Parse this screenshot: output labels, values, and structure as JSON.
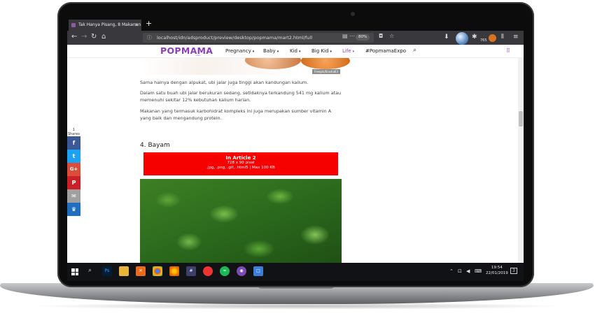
{
  "browser": {
    "tab_title": "Tak Hanya Pisang, 8 Makanan",
    "url": "localhost/idn/adsproduct/preview/desktop/popmama/mart2.html/full",
    "zoom": "80%",
    "counter": "765"
  },
  "site": {
    "logo": "POPMAMA",
    "logo_sub": ".com",
    "nav": [
      {
        "label": "Pregnancy",
        "has_caret": true
      },
      {
        "label": "Baby",
        "has_caret": true
      },
      {
        "label": "Kid",
        "has_caret": true
      },
      {
        "label": "Big Kid",
        "has_caret": true
      },
      {
        "label": "Life",
        "has_caret": true
      },
      {
        "label": "#PopmamaExpo",
        "has_caret": false
      }
    ],
    "accent_color": "#8d3fb7"
  },
  "article": {
    "image_caption": "Freepik/Elasha63",
    "p1": "Sama halnya dengan alpukat, ubi jalar juga tinggi akan kandungan kalium.",
    "p2": "Dalam satu buah ubi jalar berukuran sedang, setidaknya terkandung 541 mg kalium atau memenuhi sekitar 12% kebutuhan kalium harian.",
    "p3": "Makanan yang termasuk karbohidrat kompleks ini juga merupakan sumber vitamin A yang baik dan mengandung protein.",
    "heading": "4. Bayam"
  },
  "ad": {
    "title": "In Article 2",
    "size": "728 x 90 pixel",
    "formats": ".jpg, .png, .gif, .html5 | Max 100 KB",
    "color": "#f70000"
  },
  "share": {
    "count": "1",
    "label": "Shares",
    "buttons": [
      {
        "icon": "facebook-icon",
        "glyph": "f",
        "color": "#3b5998"
      },
      {
        "icon": "twitter-icon",
        "glyph": "t",
        "color": "#1da1f2"
      },
      {
        "icon": "google-plus-icon",
        "glyph": "G+",
        "color": "#dd4b39"
      },
      {
        "icon": "pinterest-icon",
        "glyph": "P",
        "color": "#cb2027"
      },
      {
        "icon": "email-icon",
        "glyph": "✉",
        "color": "#a0a0a0"
      },
      {
        "icon": "sumome-icon",
        "glyph": "♛",
        "color": "#1e6fbf"
      }
    ]
  },
  "taskbar": {
    "time": "19:54",
    "date": "22/01/2019",
    "notifications": "3"
  }
}
